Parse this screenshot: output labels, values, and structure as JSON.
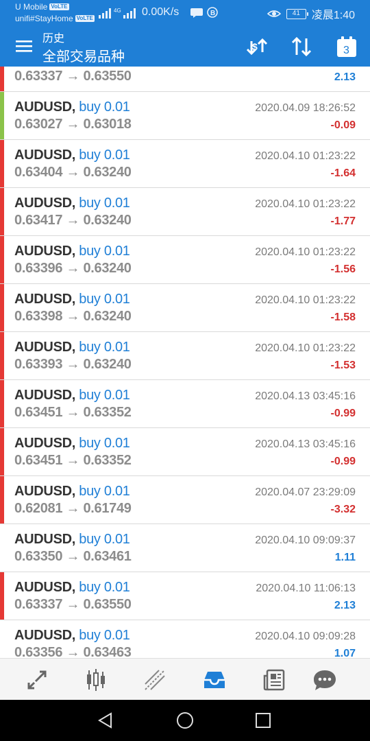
{
  "status_bar": {
    "carrier1": "U Mobile",
    "carrier2": "unifi#StayHome",
    "volte_badge": "VoLTE",
    "network_type": "4G",
    "speed": "0.00K/s",
    "battery": "41",
    "time": "凌晨1:40"
  },
  "header": {
    "subtitle": "历史",
    "title": "全部交易品种",
    "calendar_day": "3",
    "accent_color": "#1f7fd6"
  },
  "trades": [
    {
      "symbol": "AUDUSD",
      "side": "buy 0.01",
      "open": "0.63337",
      "close": "0.63550",
      "time": "",
      "profit": "2.13",
      "positive": true,
      "marker_color": "#e53935"
    },
    {
      "symbol": "AUDUSD",
      "side": "buy 0.01",
      "open": "0.63027",
      "close": "0.63018",
      "time": "2020.04.09 18:26:52",
      "profit": "-0.09",
      "positive": false,
      "marker_color": "#8bc34a"
    },
    {
      "symbol": "AUDUSD",
      "side": "buy 0.01",
      "open": "0.63404",
      "close": "0.63240",
      "time": "2020.04.10 01:23:22",
      "profit": "-1.64",
      "positive": false,
      "marker_color": "#e53935"
    },
    {
      "symbol": "AUDUSD",
      "side": "buy 0.01",
      "open": "0.63417",
      "close": "0.63240",
      "time": "2020.04.10 01:23:22",
      "profit": "-1.77",
      "positive": false,
      "marker_color": "#e53935"
    },
    {
      "symbol": "AUDUSD",
      "side": "buy 0.01",
      "open": "0.63396",
      "close": "0.63240",
      "time": "2020.04.10 01:23:22",
      "profit": "-1.56",
      "positive": false,
      "marker_color": "#e53935"
    },
    {
      "symbol": "AUDUSD",
      "side": "buy 0.01",
      "open": "0.63398",
      "close": "0.63240",
      "time": "2020.04.10 01:23:22",
      "profit": "-1.58",
      "positive": false,
      "marker_color": "#e53935"
    },
    {
      "symbol": "AUDUSD",
      "side": "buy 0.01",
      "open": "0.63393",
      "close": "0.63240",
      "time": "2020.04.10 01:23:22",
      "profit": "-1.53",
      "positive": false,
      "marker_color": "#e53935"
    },
    {
      "symbol": "AUDUSD",
      "side": "buy 0.01",
      "open": "0.63451",
      "close": "0.63352",
      "time": "2020.04.13 03:45:16",
      "profit": "-0.99",
      "positive": false,
      "marker_color": "#e53935"
    },
    {
      "symbol": "AUDUSD",
      "side": "buy 0.01",
      "open": "0.63451",
      "close": "0.63352",
      "time": "2020.04.13 03:45:16",
      "profit": "-0.99",
      "positive": false,
      "marker_color": "#e53935"
    },
    {
      "symbol": "AUDUSD",
      "side": "buy 0.01",
      "open": "0.62081",
      "close": "0.61749",
      "time": "2020.04.07 23:29:09",
      "profit": "-3.32",
      "positive": false,
      "marker_color": "#e53935"
    },
    {
      "symbol": "AUDUSD",
      "side": "buy 0.01",
      "open": "0.63350",
      "close": "0.63461",
      "time": "2020.04.10 09:09:37",
      "profit": "1.11",
      "positive": true,
      "marker_color": ""
    },
    {
      "symbol": "AUDUSD",
      "side": "buy 0.01",
      "open": "0.63337",
      "close": "0.63550",
      "time": "2020.04.10 11:06:13",
      "profit": "2.13",
      "positive": true,
      "marker_color": "#e53935"
    },
    {
      "symbol": "AUDUSD",
      "side": "buy 0.01",
      "open": "0.63356",
      "close": "0.63463",
      "time": "2020.04.10 09:09:28",
      "profit": "1.07",
      "positive": true,
      "marker_color": ""
    }
  ],
  "tabs": [
    {
      "icon": "quotes-icon",
      "active": false
    },
    {
      "icon": "candlestick-chart-icon",
      "active": false
    },
    {
      "icon": "trade-icon",
      "active": false
    },
    {
      "icon": "history-inbox-icon",
      "active": true
    },
    {
      "icon": "news-icon",
      "active": false
    },
    {
      "icon": "chat-icon",
      "active": false
    }
  ],
  "system_nav": [
    "back-icon",
    "home-icon",
    "recents-icon"
  ]
}
